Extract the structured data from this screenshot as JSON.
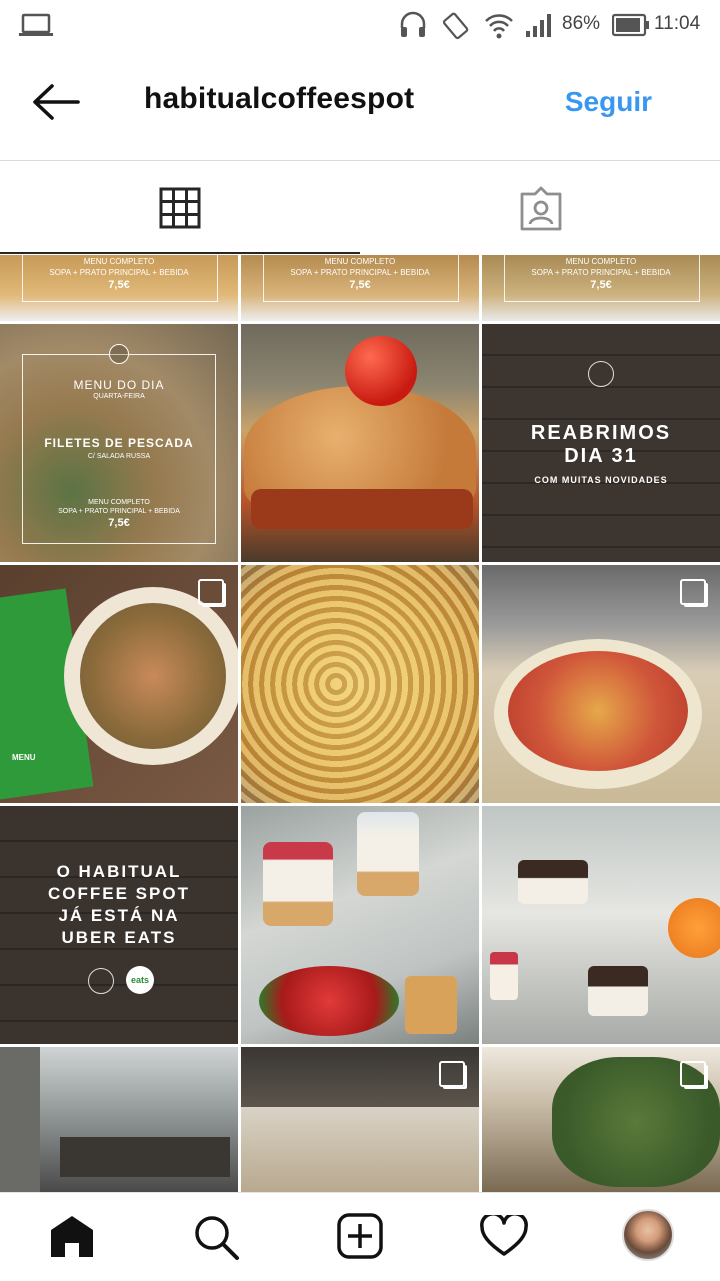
{
  "status": {
    "battery": "86%",
    "time": "11:04"
  },
  "header": {
    "username": "habitualcoffeespot",
    "follow_label": "Seguir"
  },
  "posts": {
    "row0": [
      {
        "line1": "MENU COMPLETO",
        "line2": "SOPA + PRATO PRINCIPAL + BEBIDA",
        "price": "7,5€"
      },
      {
        "line1": "MENU COMPLETO",
        "line2": "SOPA + PRATO PRINCIPAL + BEBIDA",
        "price": "7,5€"
      },
      {
        "line1": "MENU COMPLETO",
        "line2": "SOPA + PRATO PRINCIPAL + BEBIDA",
        "price": "7,5€"
      }
    ],
    "menu": {
      "title": "MENU DO DIA",
      "day": "QUARTA-FEIRA",
      "dish": "FILETES DE PESCADA",
      "side": "C/ SALADA RUSSA",
      "line1": "MENU COMPLETO",
      "line2": "SOPA + PRATO PRINCIPAL + BEBIDA",
      "price": "7,5€"
    },
    "reopen": {
      "line1": "REABRIMOS",
      "line2": "DIA 31",
      "line3": "COM MUITAS NOVIDADES"
    },
    "uber": {
      "line1": "O HABITUAL",
      "line2": "COFFEE SPOT",
      "line3": "JÁ ESTÁ NA",
      "line4": "UBER EATS",
      "badge_text": "eats"
    },
    "menu_card_text": "MENU"
  },
  "icons": {
    "tab_grid": "grid-icon",
    "tab_tagged": "tagged-icon",
    "nav": [
      "home-icon",
      "search-icon",
      "add-icon",
      "heart-icon",
      "profile-avatar"
    ]
  },
  "colors": {
    "accent": "#3897f0",
    "wood": "#3a332e"
  }
}
